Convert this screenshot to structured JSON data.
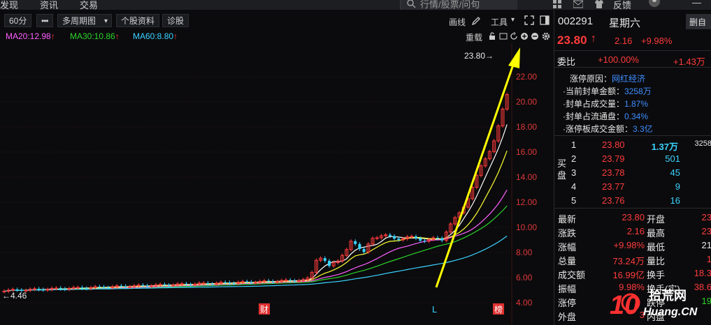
{
  "topnav": {
    "items": [
      "发现",
      "资讯",
      "交易"
    ],
    "search_placeholder": "行情/股票/问句",
    "feedback": "反馈"
  },
  "toolbar": {
    "period": "60分",
    "more": "•••",
    "multi_period": "多周期图",
    "profile": "个股资料",
    "diagnose": "诊股",
    "draw": "画线",
    "tools": "工具",
    "tools_arrow": "▾"
  },
  "ma": [
    {
      "label": "MA20:12.98",
      "color": "#ff60ff"
    },
    {
      "label": "MA30:10.86",
      "color": "#2bd42b"
    },
    {
      "label": "MA60:8.80",
      "color": "#3ad3ff"
    }
  ],
  "ma_arrow": "↑",
  "overlay_label": "重载",
  "chart_data": {
    "type": "candlestick",
    "y_ticks": [
      "22.00",
      "20.00",
      "18.00",
      "16.00",
      "14.00",
      "12.00",
      "10.00",
      "8.00",
      "6.00",
      "4.00"
    ],
    "ylim": [
      4.0,
      24.0
    ],
    "high_label": "23.80→",
    "low_label": "←4.46",
    "markers": [
      "财",
      "L",
      "榜"
    ],
    "grid": true
  },
  "quote": {
    "code": "002291",
    "name": "星期六",
    "side_btn": "删自",
    "price": "23.80",
    "arrow": "↑",
    "change": "2.16",
    "change_pct": "+9.98%"
  },
  "order_ratio": {
    "label": "委比",
    "pct": "+100.00%",
    "diff": "+1.43万"
  },
  "limit_info": [
    {
      "label": "涨停原因：",
      "value": "网红经济"
    },
    {
      "label": "·当前封单金额：",
      "value": "3258万"
    },
    {
      "label": "·封单占成交量：",
      "value": "1.87%"
    },
    {
      "label": "·封单占流通盘：",
      "value": "0.34%"
    },
    {
      "label": "·涨停板成交金额：",
      "value": "3.3亿"
    }
  ],
  "buy_label": "买盘",
  "bids": [
    {
      "level": "1",
      "price": "23.80",
      "vol": "1.37万",
      "extra": "3258"
    },
    {
      "level": "2",
      "price": "23.79",
      "vol": "501",
      "extra": ""
    },
    {
      "level": "3",
      "price": "23.78",
      "vol": "45",
      "extra": ""
    },
    {
      "level": "4",
      "price": "23.77",
      "vol": "9",
      "extra": ""
    },
    {
      "level": "5",
      "price": "23.76",
      "vol": "16",
      "extra": ""
    }
  ],
  "stats": [
    {
      "l1": "最新",
      "v1": "23.80",
      "c1": "red",
      "l2": "开盘",
      "v2": "23",
      "c2": "red"
    },
    {
      "l1": "涨跌",
      "v1": "2.16",
      "c1": "red",
      "l2": "最高",
      "v2": "23",
      "c2": "red"
    },
    {
      "l1": "涨幅",
      "v1": "+9.98%",
      "c1": "red",
      "l2": "最低",
      "v2": "21",
      "c2": "white"
    },
    {
      "l1": "总量",
      "v1": "73.24万",
      "c1": "red",
      "l2": "量比",
      "v2": "1",
      "c2": "red"
    },
    {
      "l1": "成交额",
      "v1": "16.99亿",
      "c1": "red",
      "l2": "换手",
      "v2": "18.3",
      "c2": "red"
    },
    {
      "l1": "振幅",
      "v1": "9.98%",
      "c1": "red",
      "l2": "换手(实)",
      "v2": "38.6",
      "c2": "red"
    },
    {
      "l1": "涨停",
      "v1": "",
      "c1": "red",
      "l2": "跌停",
      "v2": "19",
      "c2": "green"
    },
    {
      "l1": "外盘",
      "v1": "3",
      "c1": "red",
      "l2": "内盘",
      "v2": "",
      "c2": "green"
    }
  ],
  "watermark": {
    "top": "拾荒网",
    "bottom": "Huang.CN",
    "number": "10"
  }
}
